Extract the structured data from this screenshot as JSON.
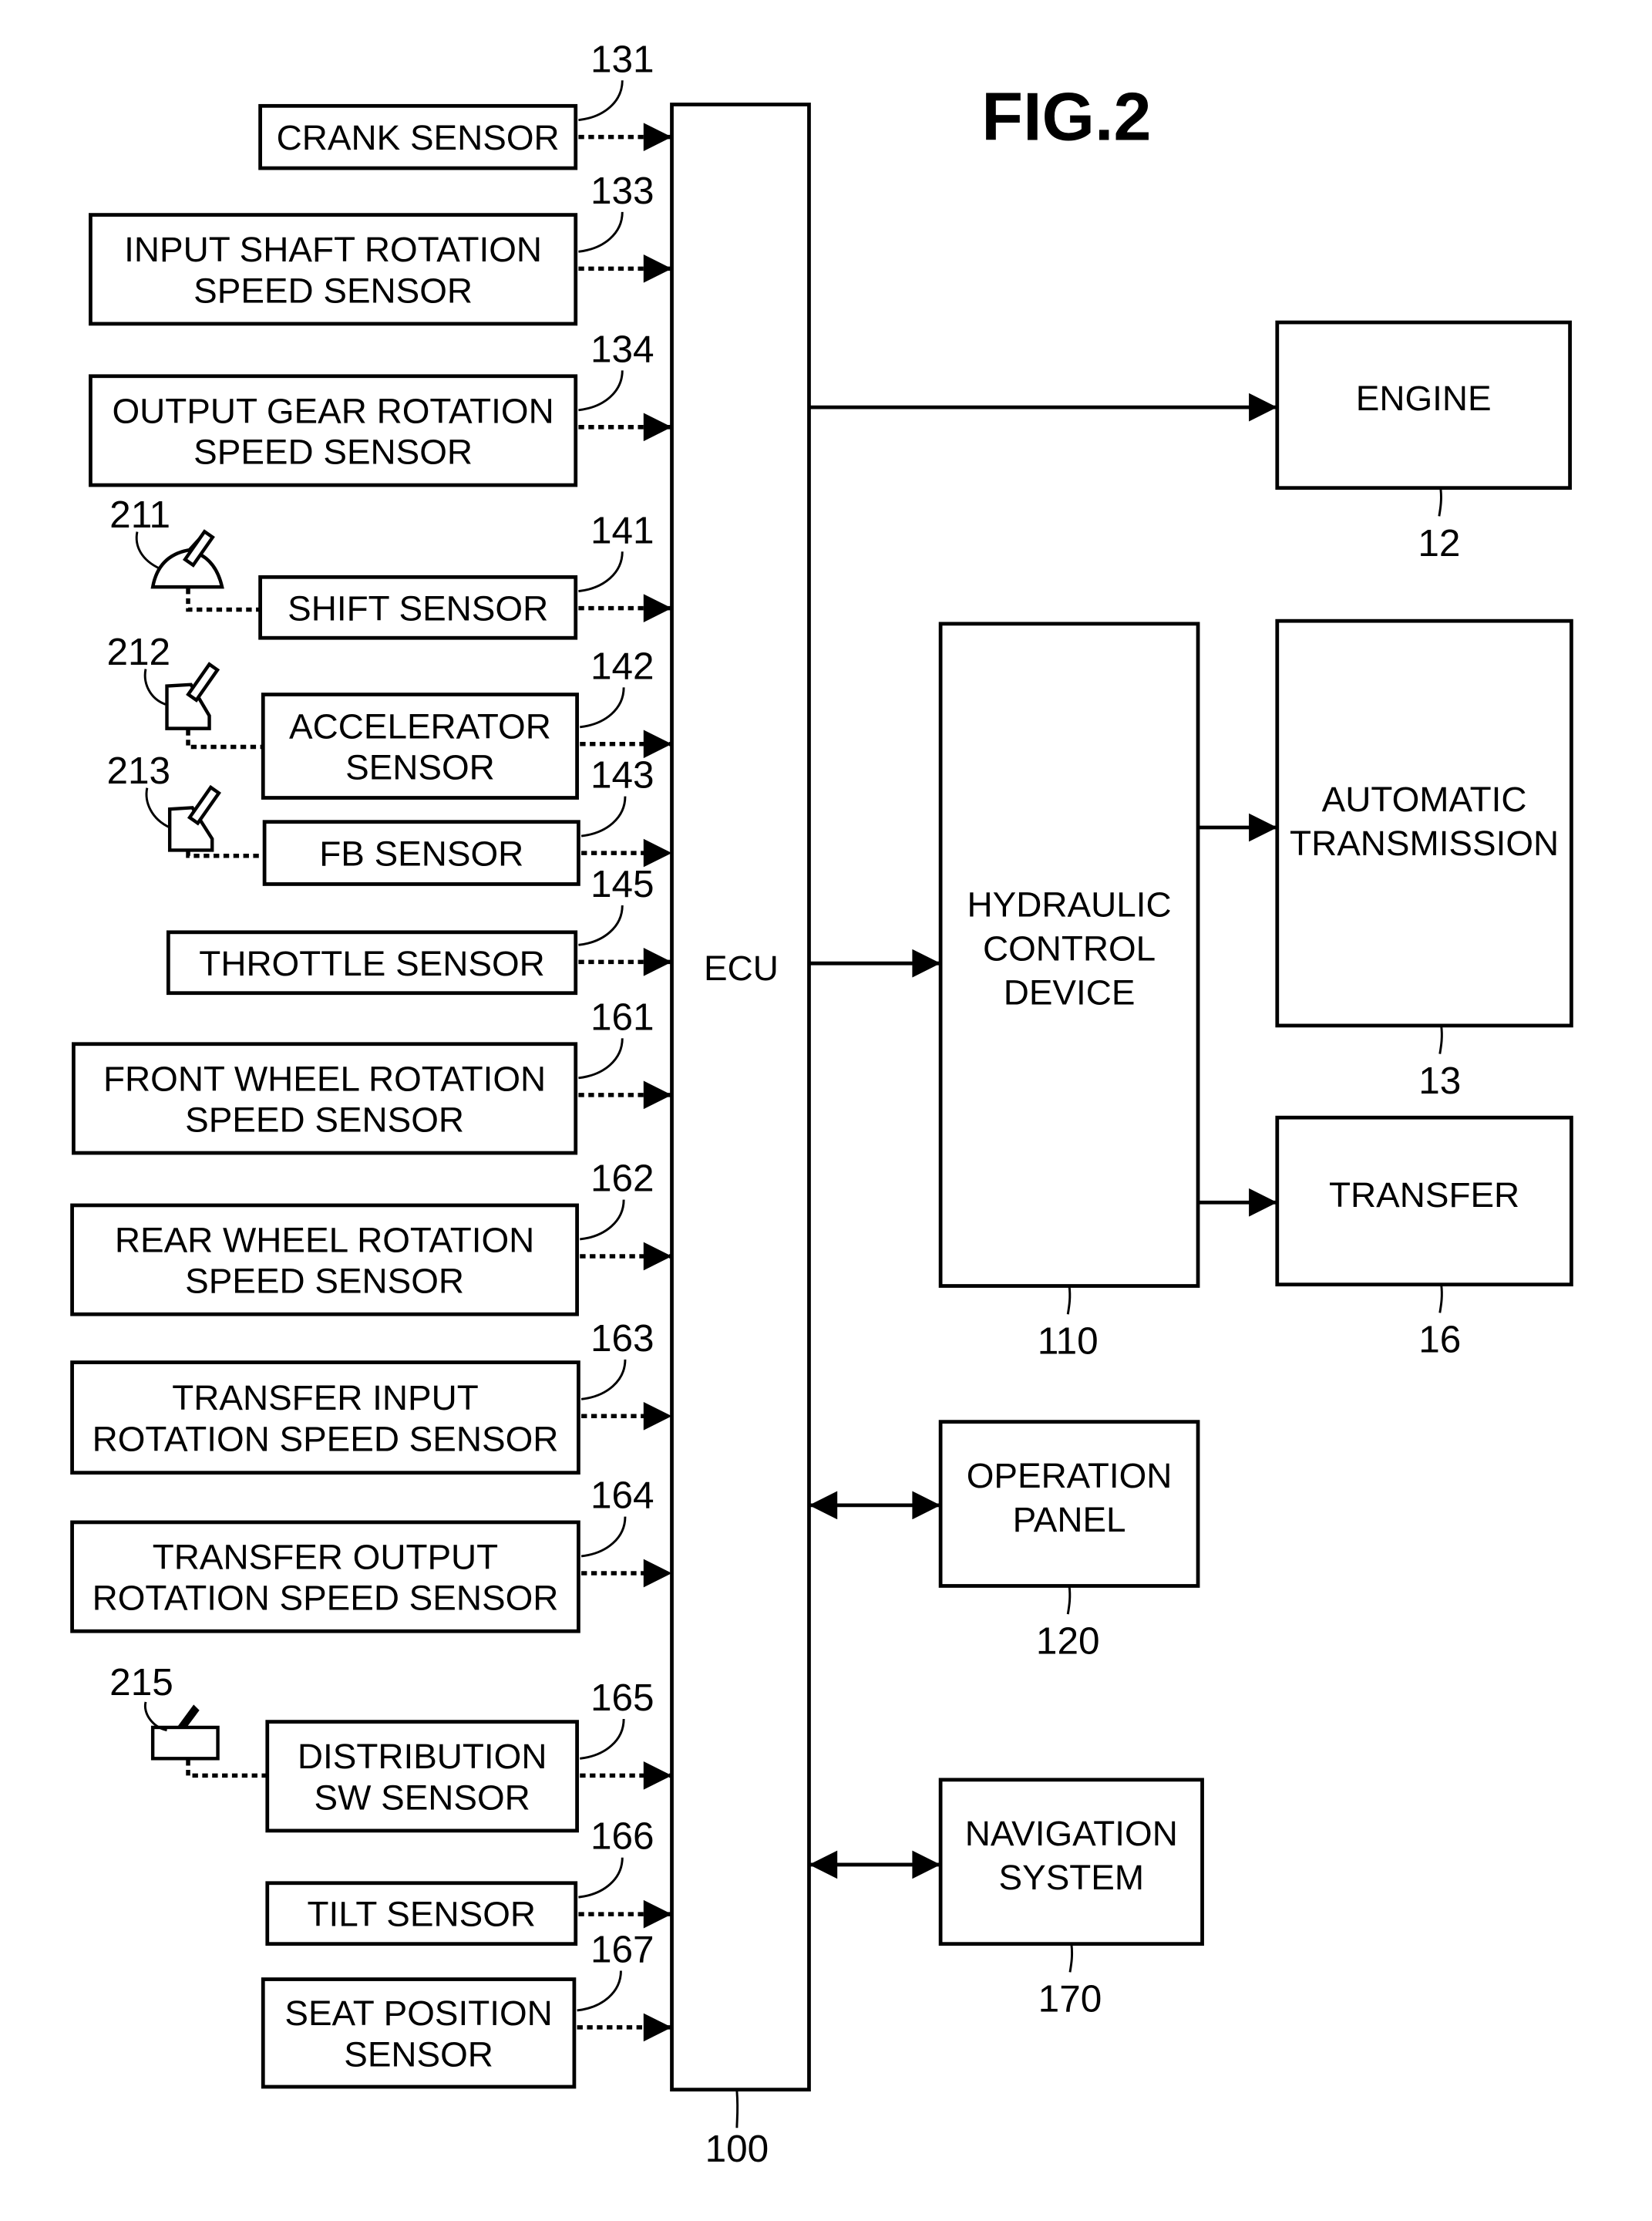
{
  "figure": {
    "title": "FIG.2"
  },
  "ecu": {
    "label": "ECU",
    "ref": "100"
  },
  "sensors": [
    {
      "id": "crank",
      "lines": [
        "CRANK SENSOR"
      ],
      "ref": "131"
    },
    {
      "id": "input-shaft",
      "lines": [
        "INPUT SHAFT ROTATION",
        "SPEED SENSOR"
      ],
      "ref": "133"
    },
    {
      "id": "output-gear",
      "lines": [
        "OUTPUT GEAR ROTATION",
        "SPEED SENSOR"
      ],
      "ref": "134"
    },
    {
      "id": "shift",
      "lines": [
        "SHIFT SENSOR"
      ],
      "ref": "141"
    },
    {
      "id": "accelerator",
      "lines": [
        "ACCELERATOR",
        "SENSOR"
      ],
      "ref": "142"
    },
    {
      "id": "fb",
      "lines": [
        "FB SENSOR"
      ],
      "ref": "143"
    },
    {
      "id": "throttle",
      "lines": [
        "THROTTLE SENSOR"
      ],
      "ref": "145"
    },
    {
      "id": "front-wheel",
      "lines": [
        "FRONT WHEEL ROTATION",
        "SPEED SENSOR"
      ],
      "ref": "161"
    },
    {
      "id": "rear-wheel",
      "lines": [
        "REAR WHEEL ROTATION",
        "SPEED SENSOR"
      ],
      "ref": "162"
    },
    {
      "id": "transfer-input",
      "lines": [
        "TRANSFER INPUT",
        "ROTATION SPEED SENSOR"
      ],
      "ref": "163"
    },
    {
      "id": "transfer-output",
      "lines": [
        "TRANSFER OUTPUT",
        "ROTATION SPEED SENSOR"
      ],
      "ref": "164"
    },
    {
      "id": "distribution-sw",
      "lines": [
        "DISTRIBUTION",
        "SW SENSOR"
      ],
      "ref": "165"
    },
    {
      "id": "tilt",
      "lines": [
        "TILT SENSOR"
      ],
      "ref": "166"
    },
    {
      "id": "seat-position",
      "lines": [
        "SEAT POSITION",
        "SENSOR"
      ],
      "ref": "167"
    }
  ],
  "operators": [
    {
      "id": "shift-lever",
      "icon": "shift-lever-icon",
      "ref": "211"
    },
    {
      "id": "accelerator-pedal",
      "icon": "accelerator-pedal-icon",
      "ref": "212"
    },
    {
      "id": "brake-pedal",
      "icon": "brake-pedal-icon",
      "ref": "213"
    },
    {
      "id": "distribution-switch",
      "icon": "toggle-switch-icon",
      "ref": "215"
    }
  ],
  "outputs": [
    {
      "id": "engine",
      "lines": [
        "ENGINE"
      ],
      "ref": "12"
    },
    {
      "id": "hydraulic",
      "lines": [
        "HYDRAULIC",
        "CONTROL",
        "DEVICE"
      ],
      "ref": "110"
    },
    {
      "id": "automatic-transmission",
      "lines": [
        "AUTOMATIC",
        "TRANSMISSION"
      ],
      "ref": "13"
    },
    {
      "id": "transfer",
      "lines": [
        "TRANSFER"
      ],
      "ref": "16"
    },
    {
      "id": "operation-panel",
      "lines": [
        "OPERATION",
        "PANEL"
      ],
      "ref": "120"
    },
    {
      "id": "navigation",
      "lines": [
        "NAVIGATION",
        "SYSTEM"
      ],
      "ref": "170"
    }
  ]
}
